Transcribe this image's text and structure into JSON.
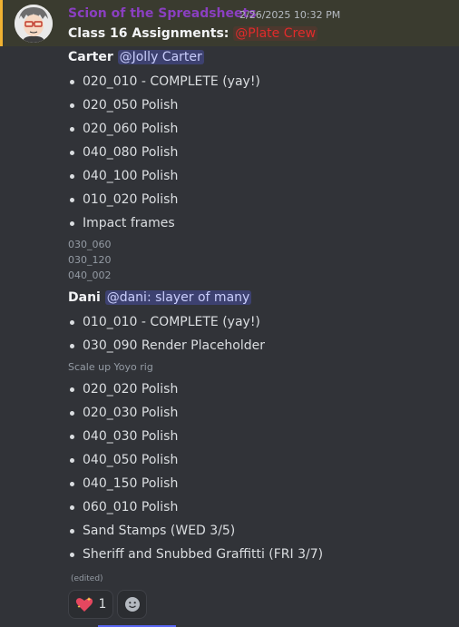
{
  "header": {
    "author": "Scion of the Spreadsheets",
    "timestamp": "2/26/2025 10:32 PM"
  },
  "intro": {
    "label": "Class 16 Assignments:",
    "role_mention": "@Plate Crew"
  },
  "carter": {
    "name": "Carter",
    "mention": "@Jolly Carter",
    "tasks": [
      "020_010 - COMPLETE (yay!)",
      "020_050 Polish",
      "020_060 Polish",
      "040_080 Polish",
      "040_100 Polish",
      "010_020 Polish",
      "Impact frames"
    ],
    "notes": [
      "030_060",
      "030_120",
      "040_002"
    ]
  },
  "dani": {
    "name": "Dani",
    "mention": "@dani: slayer of many",
    "tasks_a": [
      "010_010 - COMPLETE (yay!)",
      "030_090 Render Placeholder"
    ],
    "note": "Scale up Yoyo rig",
    "tasks_b": [
      "020_020 Polish",
      "020_030 Polish",
      "040_030 Polish",
      "040_050 Polish",
      "040_150 Polish",
      "060_010 Polish",
      "Sand Stamps (WED 3/5)",
      "Sheriff and Snubbed Graffitti (FRI 3/7)"
    ]
  },
  "edited_label": "(edited)",
  "reactions": [
    {
      "emoji": "heart-sparkle-icon",
      "count": "1"
    },
    {
      "emoji": "add-reaction-icon"
    }
  ],
  "colors": {
    "author": "#8a3fc0",
    "role_mention": "#e02b2b",
    "user_mention_bg": "#4b56a8",
    "highlight": "#f0b232"
  }
}
